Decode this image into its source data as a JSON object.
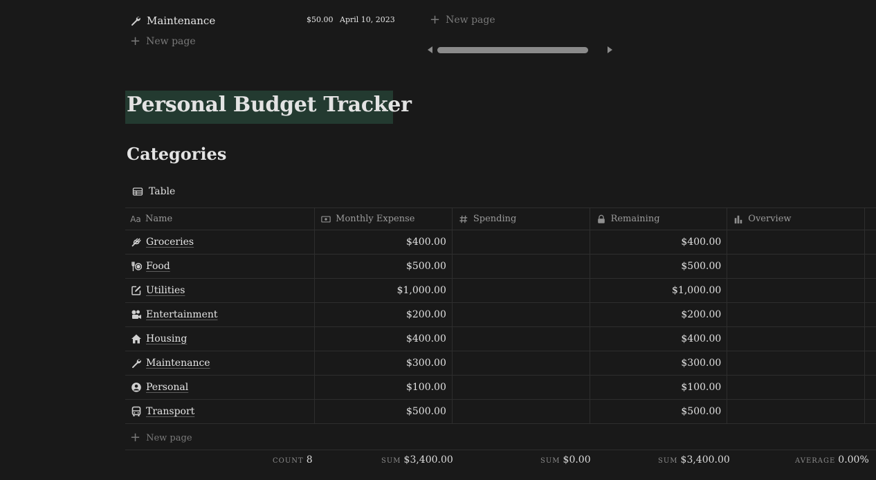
{
  "top_row": {
    "name": "Maintenance",
    "amount": "$50.00",
    "date": "April 10, 2023",
    "new_page_left": "New page",
    "new_page_right": "New page"
  },
  "page": {
    "title": "Personal Budget Tracker",
    "title_highlight_color": "#233a30",
    "section": "Categories",
    "view_tab": "Table"
  },
  "table": {
    "headers": [
      {
        "label": "Name",
        "icon": "text-aa-icon"
      },
      {
        "label": "Monthly Expense",
        "icon": "money-icon"
      },
      {
        "label": "Spending",
        "icon": "hash-icon"
      },
      {
        "label": "Remaining",
        "icon": "lock-icon"
      },
      {
        "label": "Overview",
        "icon": "bar-chart-icon"
      }
    ],
    "rows": [
      {
        "name": "Groceries",
        "icon": "wheat-icon",
        "monthly": "$400.00",
        "spending": "",
        "remaining": "$400.00",
        "overview": ""
      },
      {
        "name": "Food",
        "icon": "utensils-icon",
        "monthly": "$500.00",
        "spending": "",
        "remaining": "$500.00",
        "overview": ""
      },
      {
        "name": "Utilities",
        "icon": "edit-icon",
        "monthly": "$1,000.00",
        "spending": "",
        "remaining": "$1,000.00",
        "overview": ""
      },
      {
        "name": "Entertainment",
        "icon": "film-camera-icon",
        "monthly": "$200.00",
        "spending": "",
        "remaining": "$200.00",
        "overview": ""
      },
      {
        "name": "Housing",
        "icon": "home-icon",
        "monthly": "$400.00",
        "spending": "",
        "remaining": "$400.00",
        "overview": ""
      },
      {
        "name": "Maintenance",
        "icon": "wrench-icon",
        "monthly": "$300.00",
        "spending": "",
        "remaining": "$300.00",
        "overview": ""
      },
      {
        "name": "Personal",
        "icon": "user-circle-icon",
        "monthly": "$100.00",
        "spending": "",
        "remaining": "$100.00",
        "overview": ""
      },
      {
        "name": "Transport",
        "icon": "bus-icon",
        "monthly": "$500.00",
        "spending": "",
        "remaining": "$500.00",
        "overview": ""
      }
    ],
    "new_page": "New page",
    "footer": {
      "count_label": "COUNT",
      "count_value": "8",
      "monthly_label": "SUM",
      "monthly_value": "$3,400.00",
      "spending_label": "SUM",
      "spending_value": "$0.00",
      "remaining_label": "SUM",
      "remaining_value": "$3,400.00",
      "overview_label": "AVERAGE",
      "overview_value": "0.00%"
    }
  }
}
